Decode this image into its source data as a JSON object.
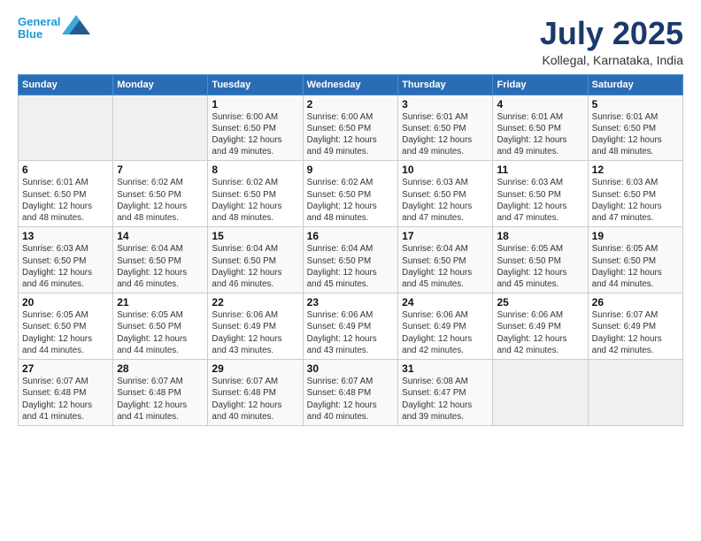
{
  "logo": {
    "line1": "General",
    "line2": "Blue"
  },
  "title": "July 2025",
  "location": "Kollegal, Karnataka, India",
  "weekdays": [
    "Sunday",
    "Monday",
    "Tuesday",
    "Wednesday",
    "Thursday",
    "Friday",
    "Saturday"
  ],
  "weeks": [
    [
      {
        "day": "",
        "detail": ""
      },
      {
        "day": "",
        "detail": ""
      },
      {
        "day": "1",
        "detail": "Sunrise: 6:00 AM\nSunset: 6:50 PM\nDaylight: 12 hours\nand 49 minutes."
      },
      {
        "day": "2",
        "detail": "Sunrise: 6:00 AM\nSunset: 6:50 PM\nDaylight: 12 hours\nand 49 minutes."
      },
      {
        "day": "3",
        "detail": "Sunrise: 6:01 AM\nSunset: 6:50 PM\nDaylight: 12 hours\nand 49 minutes."
      },
      {
        "day": "4",
        "detail": "Sunrise: 6:01 AM\nSunset: 6:50 PM\nDaylight: 12 hours\nand 49 minutes."
      },
      {
        "day": "5",
        "detail": "Sunrise: 6:01 AM\nSunset: 6:50 PM\nDaylight: 12 hours\nand 48 minutes."
      }
    ],
    [
      {
        "day": "6",
        "detail": "Sunrise: 6:01 AM\nSunset: 6:50 PM\nDaylight: 12 hours\nand 48 minutes."
      },
      {
        "day": "7",
        "detail": "Sunrise: 6:02 AM\nSunset: 6:50 PM\nDaylight: 12 hours\nand 48 minutes."
      },
      {
        "day": "8",
        "detail": "Sunrise: 6:02 AM\nSunset: 6:50 PM\nDaylight: 12 hours\nand 48 minutes."
      },
      {
        "day": "9",
        "detail": "Sunrise: 6:02 AM\nSunset: 6:50 PM\nDaylight: 12 hours\nand 48 minutes."
      },
      {
        "day": "10",
        "detail": "Sunrise: 6:03 AM\nSunset: 6:50 PM\nDaylight: 12 hours\nand 47 minutes."
      },
      {
        "day": "11",
        "detail": "Sunrise: 6:03 AM\nSunset: 6:50 PM\nDaylight: 12 hours\nand 47 minutes."
      },
      {
        "day": "12",
        "detail": "Sunrise: 6:03 AM\nSunset: 6:50 PM\nDaylight: 12 hours\nand 47 minutes."
      }
    ],
    [
      {
        "day": "13",
        "detail": "Sunrise: 6:03 AM\nSunset: 6:50 PM\nDaylight: 12 hours\nand 46 minutes."
      },
      {
        "day": "14",
        "detail": "Sunrise: 6:04 AM\nSunset: 6:50 PM\nDaylight: 12 hours\nand 46 minutes."
      },
      {
        "day": "15",
        "detail": "Sunrise: 6:04 AM\nSunset: 6:50 PM\nDaylight: 12 hours\nand 46 minutes."
      },
      {
        "day": "16",
        "detail": "Sunrise: 6:04 AM\nSunset: 6:50 PM\nDaylight: 12 hours\nand 45 minutes."
      },
      {
        "day": "17",
        "detail": "Sunrise: 6:04 AM\nSunset: 6:50 PM\nDaylight: 12 hours\nand 45 minutes."
      },
      {
        "day": "18",
        "detail": "Sunrise: 6:05 AM\nSunset: 6:50 PM\nDaylight: 12 hours\nand 45 minutes."
      },
      {
        "day": "19",
        "detail": "Sunrise: 6:05 AM\nSunset: 6:50 PM\nDaylight: 12 hours\nand 44 minutes."
      }
    ],
    [
      {
        "day": "20",
        "detail": "Sunrise: 6:05 AM\nSunset: 6:50 PM\nDaylight: 12 hours\nand 44 minutes."
      },
      {
        "day": "21",
        "detail": "Sunrise: 6:05 AM\nSunset: 6:50 PM\nDaylight: 12 hours\nand 44 minutes."
      },
      {
        "day": "22",
        "detail": "Sunrise: 6:06 AM\nSunset: 6:49 PM\nDaylight: 12 hours\nand 43 minutes."
      },
      {
        "day": "23",
        "detail": "Sunrise: 6:06 AM\nSunset: 6:49 PM\nDaylight: 12 hours\nand 43 minutes."
      },
      {
        "day": "24",
        "detail": "Sunrise: 6:06 AM\nSunset: 6:49 PM\nDaylight: 12 hours\nand 42 minutes."
      },
      {
        "day": "25",
        "detail": "Sunrise: 6:06 AM\nSunset: 6:49 PM\nDaylight: 12 hours\nand 42 minutes."
      },
      {
        "day": "26",
        "detail": "Sunrise: 6:07 AM\nSunset: 6:49 PM\nDaylight: 12 hours\nand 42 minutes."
      }
    ],
    [
      {
        "day": "27",
        "detail": "Sunrise: 6:07 AM\nSunset: 6:48 PM\nDaylight: 12 hours\nand 41 minutes."
      },
      {
        "day": "28",
        "detail": "Sunrise: 6:07 AM\nSunset: 6:48 PM\nDaylight: 12 hours\nand 41 minutes."
      },
      {
        "day": "29",
        "detail": "Sunrise: 6:07 AM\nSunset: 6:48 PM\nDaylight: 12 hours\nand 40 minutes."
      },
      {
        "day": "30",
        "detail": "Sunrise: 6:07 AM\nSunset: 6:48 PM\nDaylight: 12 hours\nand 40 minutes."
      },
      {
        "day": "31",
        "detail": "Sunrise: 6:08 AM\nSunset: 6:47 PM\nDaylight: 12 hours\nand 39 minutes."
      },
      {
        "day": "",
        "detail": ""
      },
      {
        "day": "",
        "detail": ""
      }
    ]
  ]
}
